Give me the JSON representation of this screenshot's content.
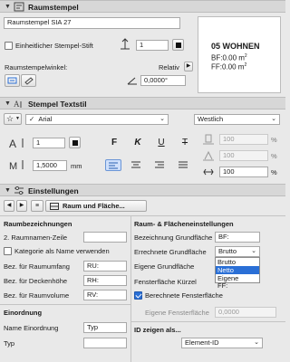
{
  "panel_raumstempel": {
    "title": "Raumstempel",
    "stamp_name": "Raumstempel SIA 27",
    "uniform_pen_label": "Einheitlicher Stempel-Stift",
    "pen_number": "1",
    "angle_label": "Raumstempelwinkel:",
    "relative_label": "Relativ",
    "angle_value": "0,0000°",
    "preview": {
      "line1": "05 WOHNEN",
      "line2_prefix": "BF:0.00 m",
      "line3_prefix": "FF:0.00 m",
      "sup": "2"
    }
  },
  "panel_textstil": {
    "title": "Stempel Textstil",
    "font_name": "Arial",
    "script_name": "Westlich",
    "pen_number": "1",
    "size_value": "1,5000",
    "size_unit": "mm",
    "bold": "F",
    "italic": "K",
    "underline": "U",
    "strike": "T",
    "width_pct": "100",
    "spacing_pct": "100",
    "slant_pct": "100",
    "pct": "%"
  },
  "panel_einstellungen": {
    "title": "Einstellungen",
    "nav_label": "Raum und Fläche...",
    "left": {
      "raumbez_heading": "Raumbezeichnungen",
      "raumnamen_label": "2. Raumnamen-Zeile",
      "kategorie_label": "Kategorie als Name verwenden",
      "umfang_label": "Bez. für Raumumfang",
      "umfang_value": "RU:",
      "decke_label": "Bez. für Deckenhöhe",
      "decke_value": "RH:",
      "volumen_label": "Bez. für Raumvolume",
      "volumen_value": "RV:",
      "einordnung_heading": "Einordnung",
      "name_einordnung_label": "Name Einordnung",
      "name_einordnung_value": "Typ",
      "typ_label": "Typ"
    },
    "right": {
      "heading": "Raum- & Flächeneinstellungen",
      "grundflaeche_label": "Bezeichnung Grundfläche",
      "grundflaeche_value": "BF:",
      "errechnete_label": "Errechnete Grundfläche",
      "errechnete_value": "Brutto",
      "dropdown_options": [
        "Brutto",
        "Netto",
        "Eigene"
      ],
      "dropdown_selected": "Netto",
      "eigene_label": "Eigene Grundfläche",
      "fenster_kuerzel_label": "Fensterfläche Kürzel",
      "fenster_kuerzel_value": "FF:",
      "berechnete_label": "Berechnete Fensterfläche",
      "eigene_fenster_label": "Eigene Fensterfläche",
      "eigene_fenster_value": "0,0000",
      "id_heading": "ID zeigen als...",
      "id_value": "Element-ID"
    }
  },
  "colors": {
    "accent": "#2a6fd6",
    "selected_option_bg": "#2a6fd6"
  }
}
